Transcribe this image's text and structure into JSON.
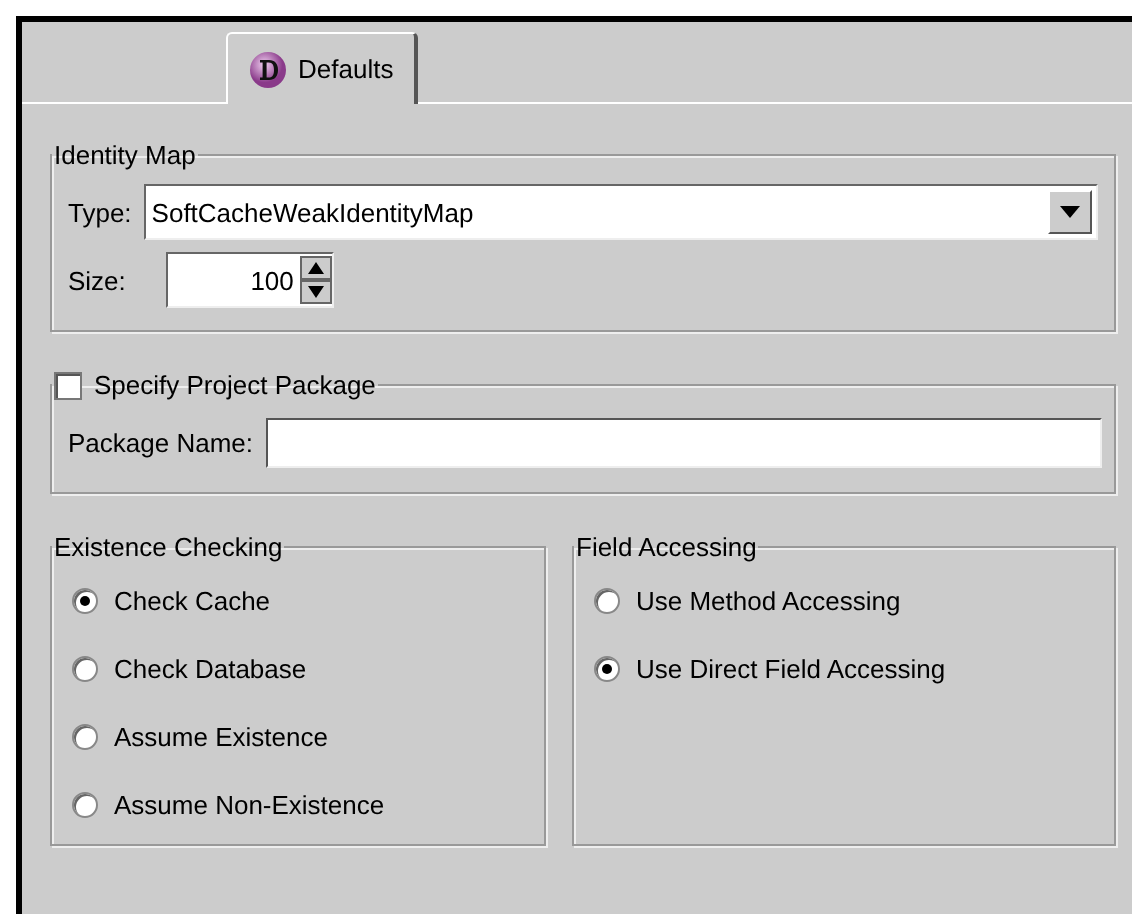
{
  "tabs": [
    {
      "label": "Defaults",
      "selected": true
    }
  ],
  "identity_map": {
    "title": "Identity Map",
    "type_label": "Type:",
    "type_value": "SoftCacheWeakIdentityMap",
    "size_label": "Size:",
    "size_value": "100"
  },
  "project_package": {
    "label": "Specify Project Package",
    "checked": false,
    "package_name_label": "Package Name:"
  },
  "existence_checking": {
    "title": "Existence Checking",
    "options": [
      {
        "label": "Check Cache",
        "selected": true
      },
      {
        "label": "Check Database",
        "selected": false
      },
      {
        "label": "Assume Existence",
        "selected": false
      },
      {
        "label": "Assume Non-Existence",
        "selected": false
      }
    ]
  },
  "field_accessing": {
    "title": "Field Accessing",
    "options": [
      {
        "label": "Use Method Accessing",
        "selected": false
      },
      {
        "label": "Use Direct Field Accessing",
        "selected": true
      }
    ]
  }
}
